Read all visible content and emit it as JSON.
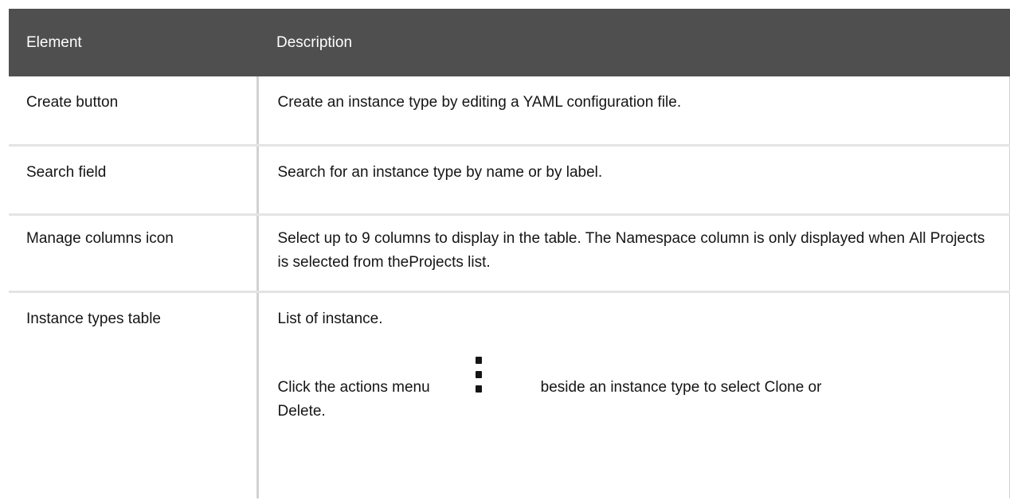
{
  "table": {
    "headers": [
      "Element",
      "Description"
    ],
    "rows": [
      {
        "element_bold": "Create",
        "element_rest": " button",
        "description": "Create an instance type by editing a YAML configuration file."
      },
      {
        "element": "Search field",
        "description": "Search for an instance type by name or by label."
      },
      {
        "element_bold": "Manage columns",
        "element_rest": " icon",
        "desc_part1": "Select up to 9 columns to display in the table. The ",
        "desc_bold1": "Namespace",
        "desc_part2": " column is only displayed when ",
        "desc_bold2": "All Projects",
        "desc_part3": " is selected from the",
        "desc_bold3": "Projects",
        "desc_part4": " list."
      },
      {
        "element": "Instance types table",
        "desc_line1": "List of instance.",
        "desc_part1": "Click the actions menu",
        "actions_icon": "kebab-icon",
        "desc_part2": "beside an instance type to select ",
        "desc_bold1": "Clone",
        "desc_part3": " or ",
        "desc_bold2": "Delete",
        "desc_part4": "."
      }
    ]
  }
}
